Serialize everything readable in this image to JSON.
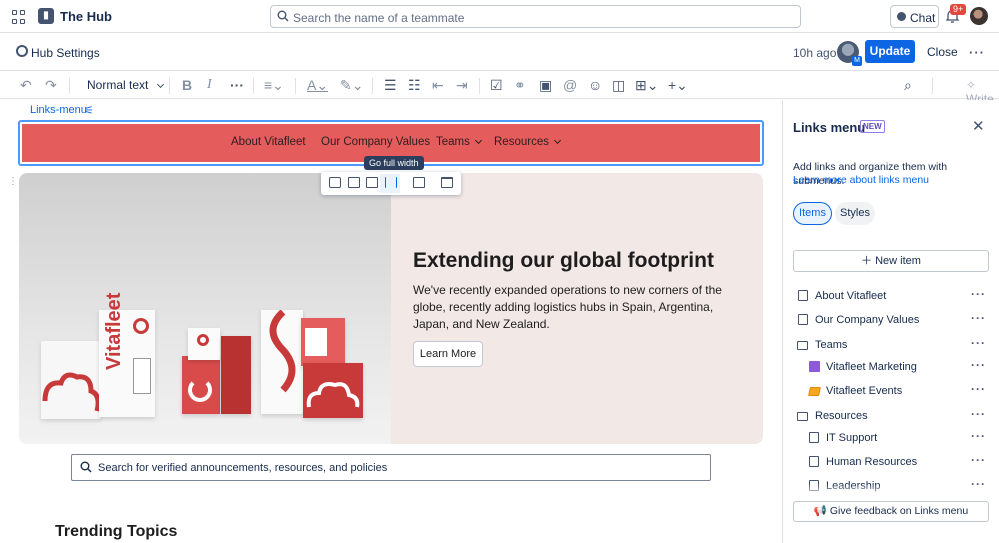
{
  "topbar": {
    "app_title": "The Hub",
    "search_placeholder": "Search the name of a teammate",
    "chat_label": "Chat",
    "notification_count": "9+"
  },
  "subbar": {
    "settings_label": "Hub Settings",
    "last_edited": "10h ago",
    "update_label": "Update",
    "close_label": "Close"
  },
  "toolbar": {
    "text_style": "Normal text",
    "write_label": "Write"
  },
  "canvas": {
    "links_menu_label": "Links-menu",
    "menu_items": [
      {
        "label": "About Vitafleet",
        "has_submenu": false
      },
      {
        "label": "Our Company Values",
        "has_submenu": false
      },
      {
        "label": "Teams",
        "has_submenu": true
      },
      {
        "label": "Resources",
        "has_submenu": true
      }
    ],
    "menu_color": "#e55c5c",
    "tooltip": "Go full width",
    "hero": {
      "title": "Extending our global footprint",
      "description": "We've recently expanded operations to new corners of the globe, recently adding logistics hubs in Spain, Argentina, Japan, and New Zealand.",
      "button_label": "Learn More",
      "brand_text": "Vitafleet",
      "background": "#f2e8e6"
    },
    "search_placeholder": "Search for verified announcements, resources, and policies",
    "section_heading": "Trending Topics"
  },
  "panel": {
    "title": "Links menu",
    "new_badge": "NEW",
    "description": "Add links and organize them with submenus.",
    "learn_link": "Learn more about links menu",
    "tabs": {
      "items": "Items",
      "styles": "Styles"
    },
    "new_item_label": "New item",
    "items": [
      {
        "label": "About Vitafleet",
        "icon": "page-icon"
      },
      {
        "label": "Our Company Values",
        "icon": "page-icon"
      },
      {
        "label": "Teams",
        "icon": "submenu-icon"
      },
      {
        "label": "Vitafleet Marketing",
        "icon": "purple-space-icon"
      },
      {
        "label": "Vitafleet Events",
        "icon": "yellow-space-icon"
      },
      {
        "label": "Resources",
        "icon": "submenu-icon"
      },
      {
        "label": "IT Support",
        "icon": "page-icon"
      },
      {
        "label": "Human Resources",
        "icon": "page-icon"
      },
      {
        "label": "Leadership",
        "icon": "page-icon"
      }
    ],
    "feedback_label": "Give feedback on Links menu"
  }
}
